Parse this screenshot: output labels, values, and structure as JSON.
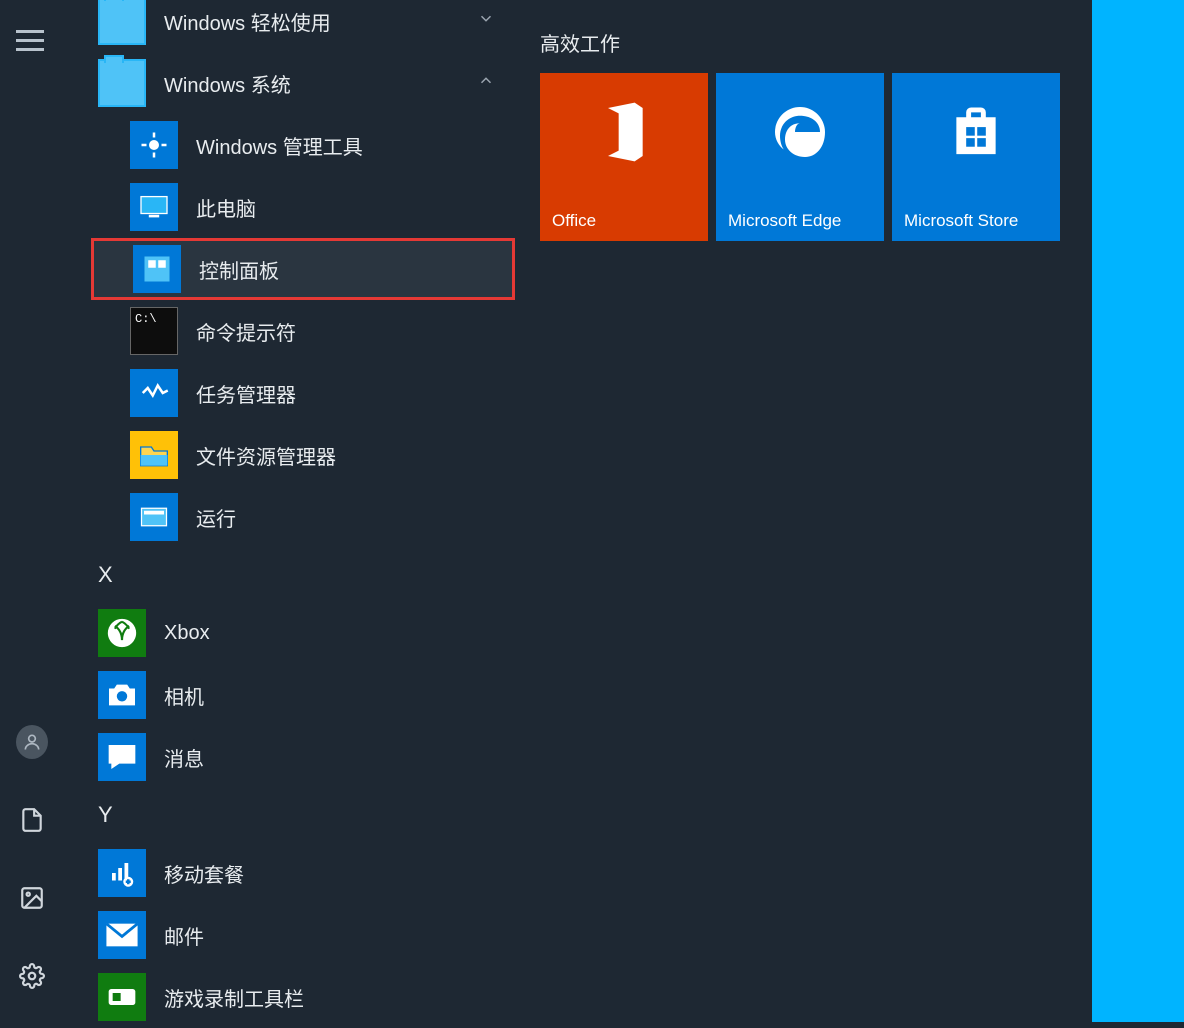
{
  "leftRail": {
    "hamburger": "menu"
  },
  "appList": {
    "folders": [
      {
        "label": "Windows 轻松使用",
        "expanded": false
      },
      {
        "label": "Windows 系统",
        "expanded": true
      }
    ],
    "systemItems": [
      {
        "label": "Windows 管理工具",
        "icon": "admin-tools"
      },
      {
        "label": "此电脑",
        "icon": "this-pc"
      },
      {
        "label": "控制面板",
        "icon": "control-panel",
        "highlighted": true
      },
      {
        "label": "命令提示符",
        "icon": "cmd"
      },
      {
        "label": "任务管理器",
        "icon": "task-manager"
      },
      {
        "label": "文件资源管理器",
        "icon": "file-explorer"
      },
      {
        "label": "运行",
        "icon": "run"
      }
    ],
    "sectionX": "X",
    "xItems": [
      {
        "label": "Xbox",
        "icon": "xbox"
      },
      {
        "label": "相机",
        "icon": "camera"
      },
      {
        "label": "消息",
        "icon": "messaging"
      }
    ],
    "sectionY": "Y",
    "yItems": [
      {
        "label": "移动套餐",
        "icon": "mobile-plans"
      },
      {
        "label": "邮件",
        "icon": "mail"
      },
      {
        "label": "游戏录制工具栏",
        "icon": "game-bar"
      }
    ]
  },
  "tiles": {
    "header": "高效工作",
    "items": [
      {
        "label": "Office",
        "type": "office"
      },
      {
        "label": "Microsoft Edge",
        "type": "edge"
      },
      {
        "label": "Microsoft Store",
        "type": "store"
      }
    ]
  }
}
